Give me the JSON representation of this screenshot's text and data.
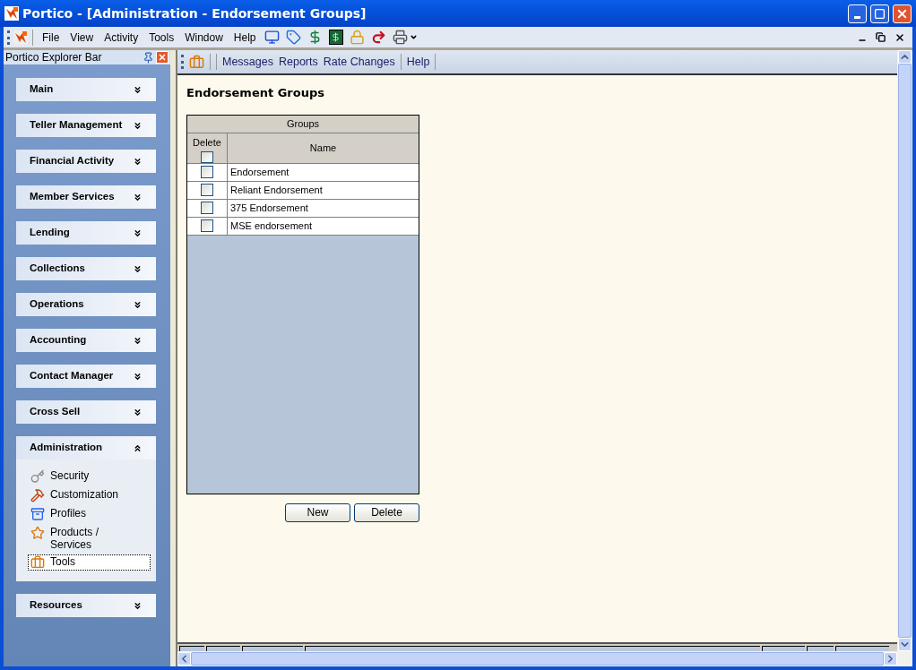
{
  "window": {
    "title": "Portico - [Administration - Endorsement Groups]"
  },
  "menu": [
    "File",
    "View",
    "Activity",
    "Tools",
    "Window",
    "Help"
  ],
  "explorer": {
    "title": "Portico Explorer Bar",
    "sections": [
      {
        "label": "Main",
        "expanded": false
      },
      {
        "label": "Teller Management",
        "expanded": false
      },
      {
        "label": "Financial Activity",
        "expanded": false
      },
      {
        "label": "Member Services",
        "expanded": false
      },
      {
        "label": "Lending",
        "expanded": false
      },
      {
        "label": "Collections",
        "expanded": false
      },
      {
        "label": "Operations",
        "expanded": false
      },
      {
        "label": "Accounting",
        "expanded": false
      },
      {
        "label": "Contact Manager",
        "expanded": false
      },
      {
        "label": "Cross Sell",
        "expanded": false
      },
      {
        "label": "Administration",
        "expanded": true,
        "items": [
          {
            "label": "Security",
            "kind": "key",
            "selected": false
          },
          {
            "label": "Customization",
            "kind": "tools",
            "selected": false
          },
          {
            "label": "Profiles",
            "kind": "cabinet",
            "selected": false
          },
          {
            "label": "Products / Services",
            "kind": "star",
            "selected": false
          },
          {
            "label": "Tools",
            "kind": "toolbox",
            "selected": true
          }
        ]
      },
      {
        "label": "Resources",
        "expanded": false
      }
    ]
  },
  "toolbar": [
    "Messages",
    "Reports",
    "Rate Changes",
    "Help"
  ],
  "page": {
    "heading": "Endorsement Groups",
    "table": {
      "title": "Groups",
      "columns": [
        "Delete",
        "Name"
      ],
      "header_checked": false,
      "rows": [
        {
          "name": "Endorsement",
          "checked": false
        },
        {
          "name": "Reliant Endorsement",
          "checked": false
        },
        {
          "name": "375 Endorsement",
          "checked": false
        },
        {
          "name": "MSE endorsement",
          "checked": false
        }
      ]
    },
    "buttons": [
      "New",
      "Delete"
    ]
  }
}
